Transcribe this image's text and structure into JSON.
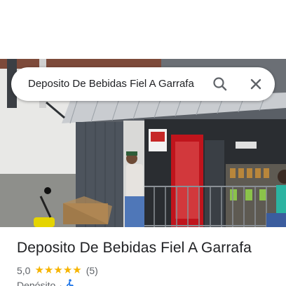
{
  "search": {
    "query": "Deposito De Bebidas Fiel A Garrafa",
    "search_icon": "search-icon",
    "close_icon": "close-icon"
  },
  "photo": {
    "description_icon": "storefront-photo"
  },
  "place": {
    "name": "Deposito De Bebidas Fiel A Garrafa",
    "rating": "5,0",
    "stars": 5,
    "review_count": "(5)",
    "category": "Depósito",
    "separator": "·",
    "accessibility_icon": "wheelchair-icon"
  },
  "colors": {
    "star": "#f6b400",
    "accessibility": "#1a73e8",
    "text_primary": "#202124",
    "text_secondary": "#5f6368"
  }
}
